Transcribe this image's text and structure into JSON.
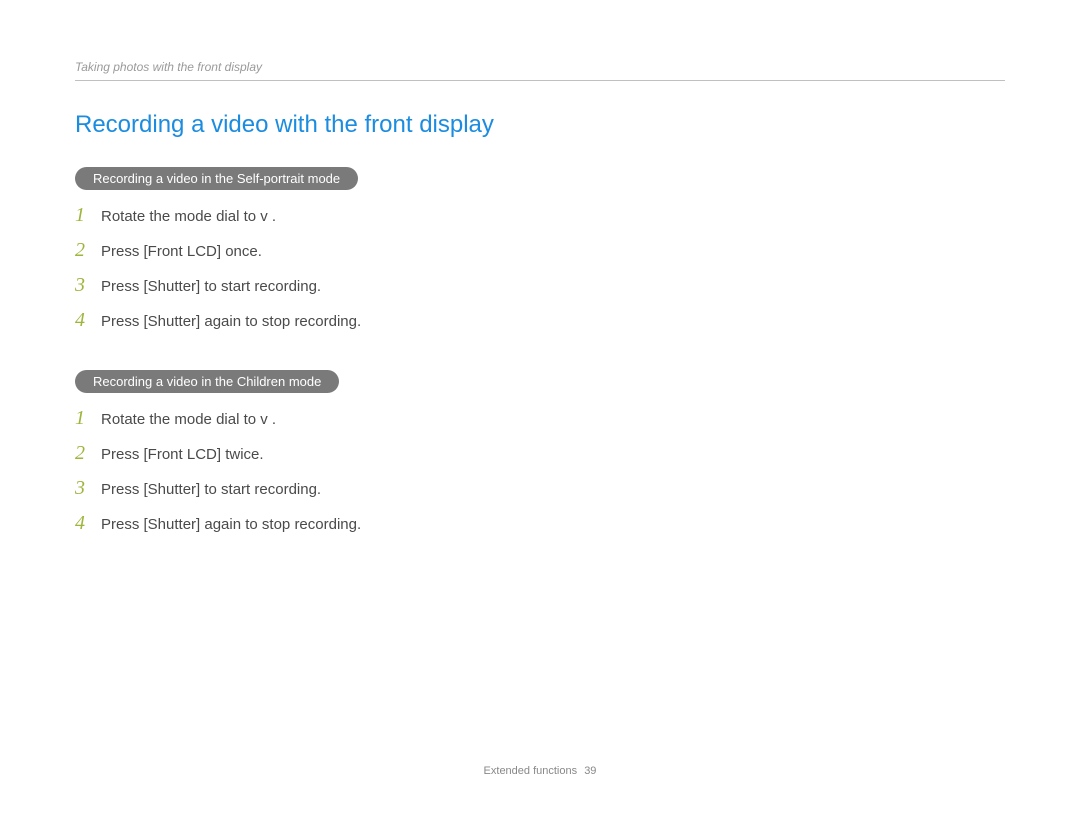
{
  "breadcrumb": "Taking photos with the front display",
  "heading": "Recording a video with the front display",
  "sections": [
    {
      "pill": "Recording a video in the Self-portrait mode",
      "steps": [
        {
          "n": "1",
          "text": "Rotate the mode dial to v   ."
        },
        {
          "n": "2",
          "text": "Press [Front LCD] once."
        },
        {
          "n": "3",
          "text": "Press [Shutter] to start recording."
        },
        {
          "n": "4",
          "text": "Press [Shutter] again to stop recording."
        }
      ]
    },
    {
      "pill": "Recording a video in the Children mode",
      "steps": [
        {
          "n": "1",
          "text": "Rotate the mode dial to v   ."
        },
        {
          "n": "2",
          "text": "Press [Front LCD] twice."
        },
        {
          "n": "3",
          "text": "Press [Shutter] to start recording."
        },
        {
          "n": "4",
          "text": "Press [Shutter] again to stop recording."
        }
      ]
    }
  ],
  "footer": {
    "section": "Extended functions",
    "page": "39"
  }
}
